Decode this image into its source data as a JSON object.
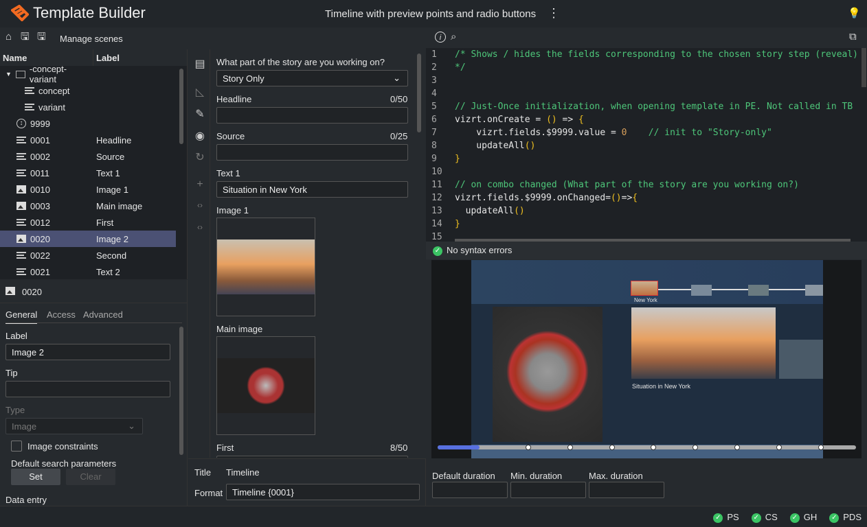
{
  "app": {
    "title": "Template Builder",
    "document_title": "Timeline with preview points and radio buttons",
    "brand_color": "#f26a21"
  },
  "toolbar": {
    "manage_scenes": "Manage scenes"
  },
  "tree": {
    "headers": [
      "Name",
      "Label"
    ],
    "rows": [
      {
        "name": "-concept-variant",
        "label": "",
        "icon": "folder-icon"
      },
      {
        "name": "concept",
        "label": "",
        "icon": "text-lines-icon"
      },
      {
        "name": "variant",
        "label": "",
        "icon": "text-lines-icon"
      },
      {
        "name": "9999",
        "label": "",
        "icon": "updown-icon"
      },
      {
        "name": "0001",
        "label": "Headline",
        "icon": "text-lines-icon"
      },
      {
        "name": "0002",
        "label": "Source",
        "icon": "text-lines-icon"
      },
      {
        "name": "0011",
        "label": "Text 1",
        "icon": "text-lines-icon"
      },
      {
        "name": "0010",
        "label": "Image 1",
        "icon": "image-icon"
      },
      {
        "name": "0003",
        "label": "Main image",
        "icon": "image-icon"
      },
      {
        "name": "0012",
        "label": "First",
        "icon": "text-lines-icon"
      },
      {
        "name": "0020",
        "label": "Image 2",
        "icon": "image-icon",
        "selected": true
      },
      {
        "name": "0022",
        "label": "Second",
        "icon": "text-lines-icon"
      },
      {
        "name": "0021",
        "label": "Text 2",
        "icon": "text-lines-icon"
      }
    ]
  },
  "detail": {
    "id": "0020",
    "tabs": [
      "General",
      "Access",
      "Advanced"
    ],
    "label_label": "Label",
    "label_value": "Image 2",
    "tip_label": "Tip",
    "tip_value": "",
    "type_label": "Type",
    "type_value": "Image",
    "constraints": "Image constraints",
    "search_params": "Default search parameters",
    "set": "Set",
    "clear": "Clear",
    "data_entry": "Data entry"
  },
  "form": {
    "question": "What part of the story are you working on?",
    "story_select": "Story Only",
    "headline": "Headline",
    "headline_count": "0/50",
    "source": "Source",
    "source_count": "0/25",
    "text1": "Text 1",
    "text1_value": "Situation in New York",
    "image1": "Image 1",
    "main_image": "Main image",
    "first": "First",
    "first_count": "8/50",
    "title_label": "Title",
    "title_value": "Timeline",
    "format_label": "Format",
    "format_value": "Timeline {0001}"
  },
  "code": {
    "lines": [
      "/* Shows / hides the fields corresponding to the chosen story step (reveal)",
      "*/",
      "",
      "",
      "// Just-Once initialization, when opening template in PE. Not called in TB",
      "vizrt.onCreate = () => {",
      "    vizrt.fields.$9999.value = 0    // init to \"Story-only\"",
      "    updateAll()",
      "}",
      "",
      "// on combo changed (What part of the story are you working on?)",
      "vizrt.fields.$9999.onChanged=()=>{",
      "  updateAll()",
      "}",
      ""
    ],
    "status": "No syntax errors"
  },
  "preview": {
    "timeline_label": "New York",
    "caption": "Situation in New York",
    "progress": 0.1,
    "points": 8
  },
  "durations": {
    "default": "Default duration",
    "min": "Min. duration",
    "max": "Max. duration"
  },
  "footer": {
    "items": [
      "PS",
      "CS",
      "GH",
      "PDS"
    ],
    "ok_color": "#3bc464"
  }
}
